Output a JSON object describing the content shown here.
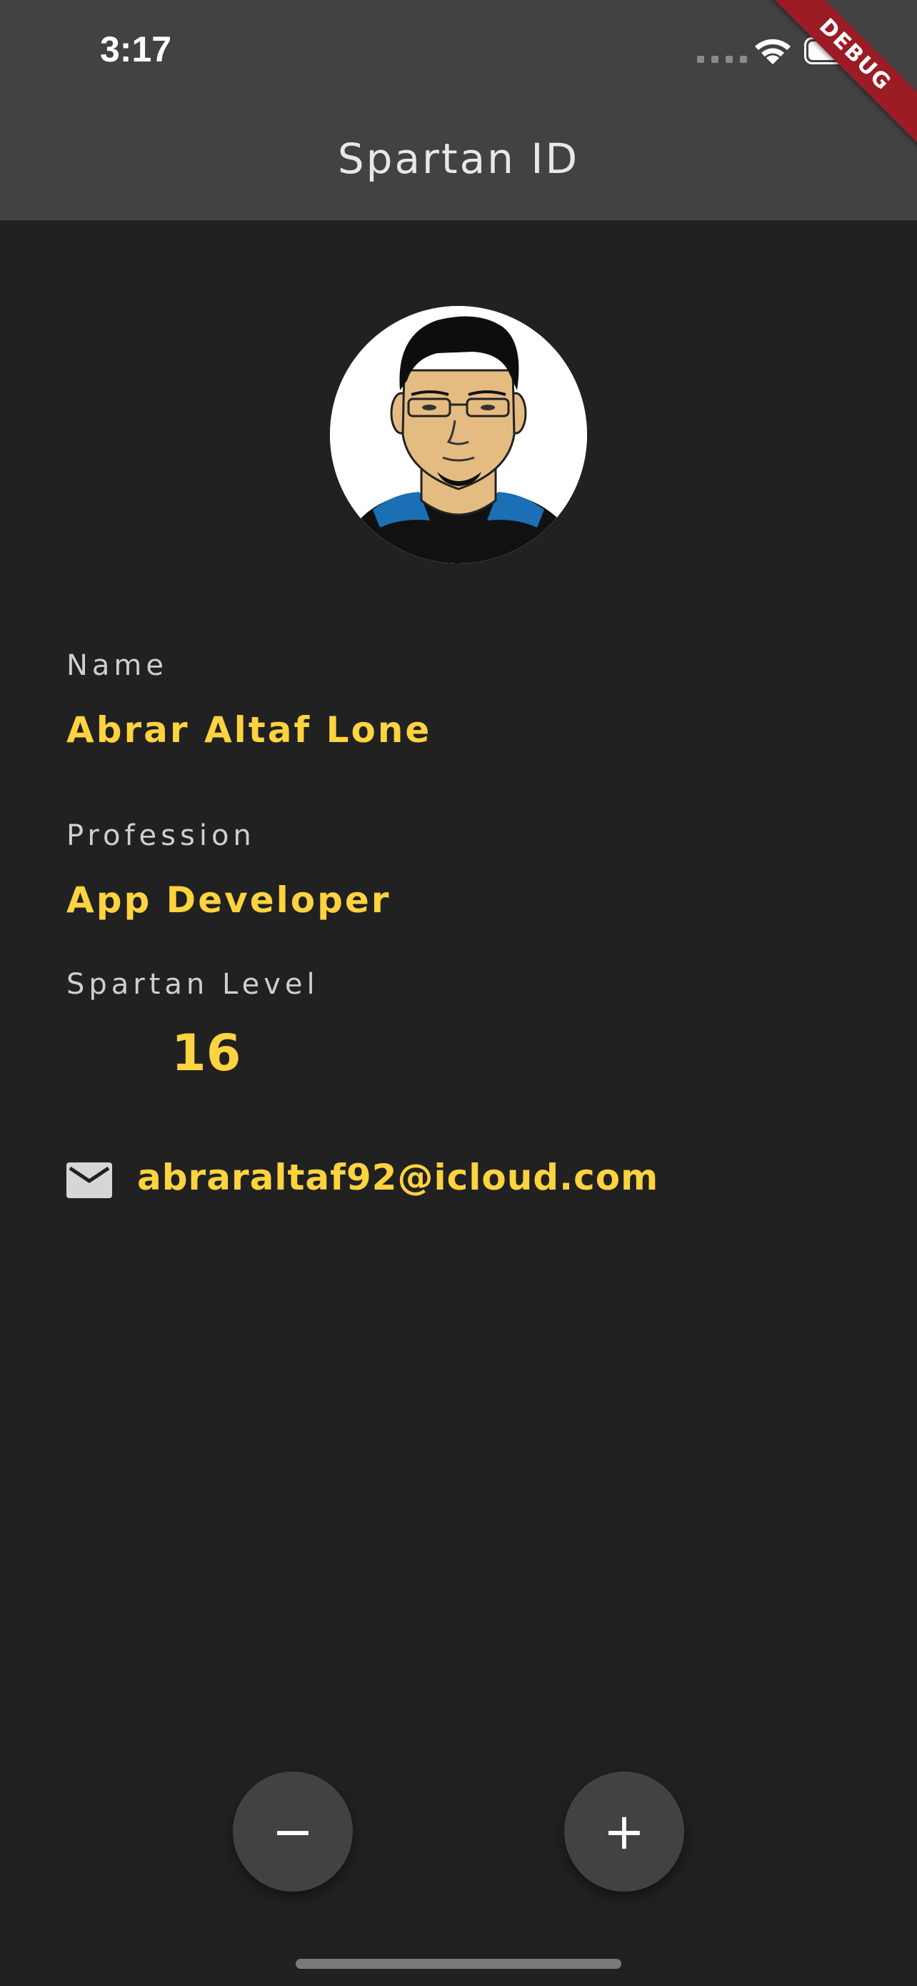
{
  "status_bar": {
    "time": "3:17",
    "wifi_icon": "wifi-icon",
    "battery_icon": "battery-icon"
  },
  "app_bar": {
    "title": "Spartan ID",
    "debug_banner": "DEBUG"
  },
  "profile": {
    "avatar_icon": "cartoon-avatar",
    "name_label": "Name",
    "name_value": "Abrar Altaf Lone",
    "profession_label": "Profession",
    "profession_value": "App Developer",
    "level_label": "Spartan Level",
    "level_value": "16",
    "email_icon": "mail-icon",
    "email_value": "abraraltaf92@icloud.com"
  },
  "controls": {
    "decrement_label": "−",
    "increment_label": "+"
  },
  "colors": {
    "background": "#212121",
    "app_bar": "#424242",
    "accent": "#FDD33F",
    "debug_ribbon": "#9B1C25"
  }
}
